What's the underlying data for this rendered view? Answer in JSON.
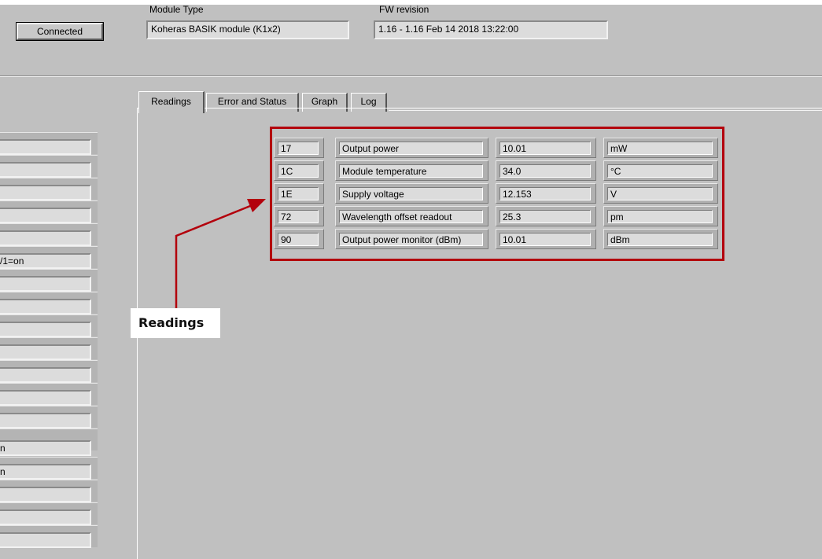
{
  "header": {
    "connect_button": "Connected",
    "module_type_label": "Module Type",
    "module_type_value": "Koheras BASIK module (K1x2)",
    "fw_label": "FW revision",
    "fw_value": "1.16 - 1.16  Feb 14 2018 13:22:00"
  },
  "tabs": [
    {
      "label": "Readings",
      "active": true
    },
    {
      "label": "Error and Status",
      "active": false
    },
    {
      "label": "Graph",
      "active": false
    },
    {
      "label": "Log",
      "active": false
    }
  ],
  "sidebar": {
    "fields": [
      "",
      "",
      "",
      "",
      "",
      "/1=on",
      "",
      "",
      "",
      "",
      "",
      "",
      "",
      "n",
      "n",
      "",
      "",
      "",
      ""
    ]
  },
  "readings": [
    {
      "register": "17",
      "name": "Output power",
      "value": "10.01",
      "unit": "mW"
    },
    {
      "register": "1C",
      "name": "Module temperature",
      "value": "34.0",
      "unit": "°C"
    },
    {
      "register": "1E",
      "name": "Supply voltage",
      "value": "12.153",
      "unit": "V"
    },
    {
      "register": "72",
      "name": "Wavelength offset readout",
      "value": "25.3",
      "unit": "pm"
    },
    {
      "register": "90",
      "name": "Output power monitor (dBm)",
      "value": "10.01",
      "unit": "dBm"
    }
  ],
  "annotation": {
    "callout_label": "Readings",
    "highlight_color": "#b3000c"
  }
}
